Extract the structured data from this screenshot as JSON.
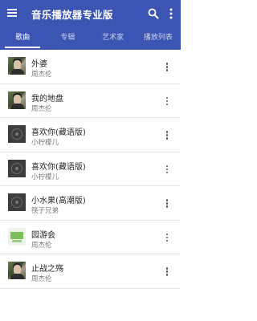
{
  "app": {
    "title": "音乐播放器专业版",
    "accent": "#3c55b3"
  },
  "toolbar": {
    "menu_icon": "menu-icon",
    "search_icon": "search-icon",
    "overflow_icon": "more-vert-icon"
  },
  "tabs": [
    {
      "label": "歌曲",
      "active": true
    },
    {
      "label": "专辑",
      "active": false
    },
    {
      "label": "艺术家",
      "active": false
    },
    {
      "label": "播放列表",
      "active": false
    }
  ],
  "songs": [
    {
      "title": "外婆",
      "artist": "周杰伦",
      "art": "photo"
    },
    {
      "title": "我的地盘",
      "artist": "周杰伦",
      "art": "photo"
    },
    {
      "title": "喜欢你(藏语版)",
      "artist": "小柠檬儿",
      "art": "disc"
    },
    {
      "title": "喜欢你(藏语版)",
      "artist": "小柠檬儿",
      "art": "disc"
    },
    {
      "title": "小水果(高潮版)",
      "artist": "筷子兄弟",
      "art": "disc"
    },
    {
      "title": "园游会",
      "artist": "周杰伦",
      "art": "green"
    },
    {
      "title": "止战之殇",
      "artist": "周杰伦",
      "art": "photo"
    }
  ]
}
